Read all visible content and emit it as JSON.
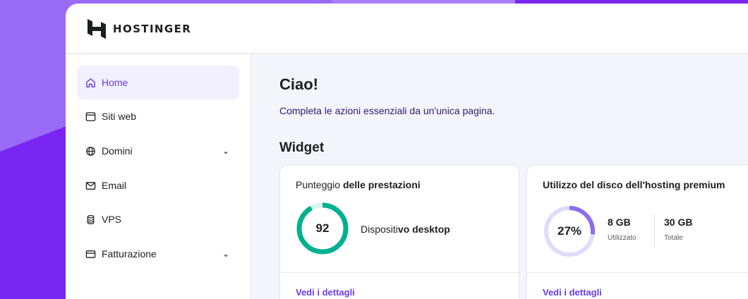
{
  "brand": {
    "name": "HOSTINGER",
    "accent": "#673de6"
  },
  "sidebar": {
    "items": [
      {
        "label": "Home",
        "icon": "home-icon",
        "active": true
      },
      {
        "label": "Siti web",
        "icon": "browser-window-icon"
      },
      {
        "label": "Domini",
        "icon": "globe-icon",
        "expandable": true
      },
      {
        "label": "Email",
        "icon": "envelope-icon"
      },
      {
        "label": "VPS",
        "icon": "server-icon"
      },
      {
        "label": "Fatturazione",
        "icon": "credit-card-icon",
        "expandable": true
      }
    ]
  },
  "main": {
    "greeting": "Ciao!",
    "subtitle": "Completa le azioni essenziali da un'unica pagina.",
    "widget_heading": "Widget",
    "performance_card": {
      "title_prefix": "Punteggio ",
      "title_bold": "delle prestazioni",
      "score": "92",
      "score_value": 92,
      "score_color": "#00b090",
      "device_prefix": "Dispositi",
      "device_bold": "vo desktop",
      "link": "Vedi i dettagli"
    },
    "disk_card": {
      "title": "Utilizzo del disco dell'hosting premium",
      "percent": "27%",
      "percent_value": 27,
      "used_value": "8 GB",
      "used_label": "Utilizzato",
      "total_value": "30 GB",
      "total_label": "Totale",
      "link": "Vedi i dettagli"
    }
  },
  "colors": {
    "background_purple": "#7a26f2",
    "background_lavender": "#9a6bf7",
    "disk_ring": "#8c6cf0",
    "disk_track": "#dedcfb"
  }
}
